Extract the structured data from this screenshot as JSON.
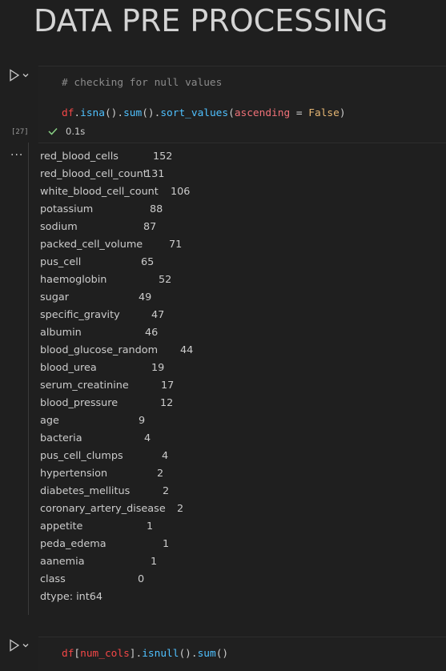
{
  "heading": "DATA PRE PROCESSING",
  "cell1": {
    "comment": "# checking for null values",
    "code": {
      "var": "df",
      "p1": ".",
      "fn1": "isna",
      "p2": "().",
      "fn2": "sum",
      "p3": "().",
      "fn3": "sort_values",
      "p4": "(",
      "kw": "ascending",
      "op": " = ",
      "val": "False",
      "p5": ")"
    },
    "exec_count": "[27]",
    "duration": "0.1s",
    "status_icon": "check-icon",
    "output": [
      {
        "name": "red_blood_cells",
        "value": "152"
      },
      {
        "name": "red_blood_cell_count",
        "value": "131"
      },
      {
        "name": "white_blood_cell_count",
        "value": "106"
      },
      {
        "name": "potassium",
        "value": "88"
      },
      {
        "name": "sodium",
        "value": "87"
      },
      {
        "name": "packed_cell_volume",
        "value": "71"
      },
      {
        "name": "pus_cell",
        "value": "65"
      },
      {
        "name": "haemoglobin",
        "value": "52"
      },
      {
        "name": "sugar",
        "value": "49"
      },
      {
        "name": "specific_gravity",
        "value": "47"
      },
      {
        "name": "albumin",
        "value": "46"
      },
      {
        "name": "blood_glucose_random",
        "value": "44"
      },
      {
        "name": "blood_urea",
        "value": "19"
      },
      {
        "name": "serum_creatinine",
        "value": "17"
      },
      {
        "name": "blood_pressure",
        "value": "12"
      },
      {
        "name": "age",
        "value": "9"
      },
      {
        "name": "bacteria",
        "value": "4"
      },
      {
        "name": "pus_cell_clumps",
        "value": "4"
      },
      {
        "name": "hypertension",
        "value": "2"
      },
      {
        "name": "diabetes_mellitus",
        "value": "2"
      },
      {
        "name": "coronary_artery_disease",
        "value": "2"
      },
      {
        "name": "appetite",
        "value": "1"
      },
      {
        "name": "peda_edema",
        "value": "1"
      },
      {
        "name": "aanemia",
        "value": "1"
      },
      {
        "name": "class",
        "value": "0"
      }
    ],
    "dtype": "dtype: int64"
  },
  "cell2": {
    "code": {
      "var": "df",
      "p1": "[",
      "arg": "num_cols",
      "p2": "].",
      "fn1": "isnull",
      "p3": "().",
      "fn2": "sum",
      "p4": "()"
    }
  },
  "icons": {
    "run": "play-icon",
    "run_menu": "chevron-down-icon",
    "more": "ellipsis-icon"
  }
}
